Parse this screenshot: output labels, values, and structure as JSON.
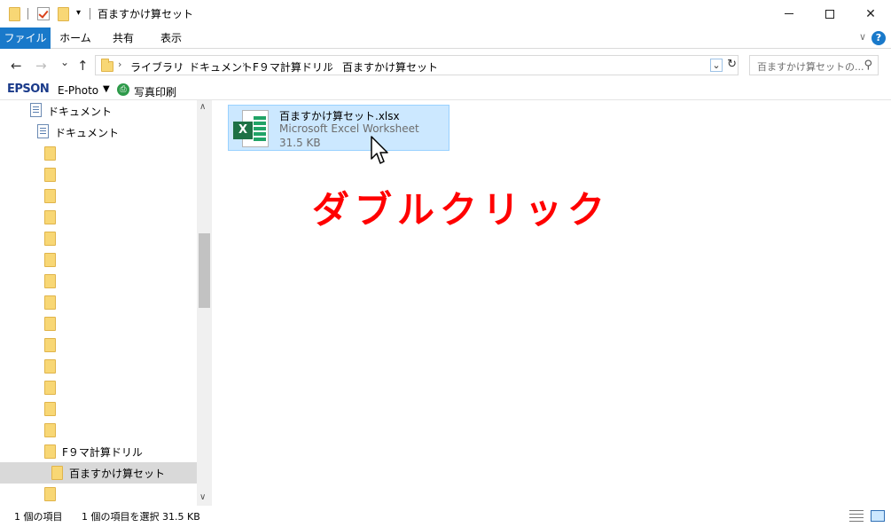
{
  "window": {
    "title": "百ますかけ算セット",
    "minimize": "—",
    "maximize": "",
    "close": "✕"
  },
  "ribbon": {
    "tabs": [
      "ファイル",
      "ホーム",
      "共有",
      "表示"
    ],
    "collapse_icon": "chevron-down-icon",
    "help": "?"
  },
  "address": {
    "back": "←",
    "forward": "→",
    "recent": "⌄",
    "up": "↑",
    "crumbs": [
      "ライブラリ",
      "ドキュメント",
      "F９マ計算ドリル",
      "百ますかけ算セット"
    ],
    "separator": "›",
    "dropdown": "⌄",
    "refresh": "↻",
    "search_placeholder": "百ますかけ算セットの..."
  },
  "epson": {
    "logo": "EPSON",
    "app": "E-Photo",
    "dropdown": "▼",
    "print_label": "写真印刷"
  },
  "navpane": {
    "items": [
      {
        "label": "ドキュメント",
        "icon": "document-library-icon",
        "indent": 1
      },
      {
        "label": "ドキュメント",
        "icon": "document-library-icon",
        "indent": 2
      },
      {
        "label": "",
        "icon": "folder-icon",
        "indent": 3
      },
      {
        "label": "",
        "icon": "folder-icon",
        "indent": 3
      },
      {
        "label": "",
        "icon": "folder-icon",
        "indent": 3
      },
      {
        "label": "",
        "icon": "folder-icon",
        "indent": 3
      },
      {
        "label": "",
        "icon": "folder-icon",
        "indent": 3
      },
      {
        "label": "",
        "icon": "folder-icon",
        "indent": 3
      },
      {
        "label": "",
        "icon": "folder-icon",
        "indent": 3
      },
      {
        "label": "",
        "icon": "folder-icon",
        "indent": 3
      },
      {
        "label": "",
        "icon": "folder-icon",
        "indent": 3
      },
      {
        "label": "",
        "icon": "folder-icon",
        "indent": 3
      },
      {
        "label": "",
        "icon": "folder-icon",
        "indent": 3
      },
      {
        "label": "",
        "icon": "folder-icon",
        "indent": 3
      },
      {
        "label": "",
        "icon": "folder-icon",
        "indent": 3
      },
      {
        "label": "",
        "icon": "folder-icon",
        "indent": 3
      },
      {
        "label": "F９マ計算ドリル",
        "icon": "folder-icon",
        "indent": 3
      },
      {
        "label": "百ますかけ算セット",
        "icon": "folder-icon",
        "indent": 4,
        "selected": true
      },
      {
        "label": "",
        "icon": "folder-icon",
        "indent": 3
      }
    ],
    "scroll_up": "∧",
    "scroll_down": "∨"
  },
  "content": {
    "file": {
      "name": "百ますかけ算セット.xlsx",
      "type": "Microsoft Excel Worksheet",
      "size": "31.5 KB",
      "icon": "excel-file-icon",
      "badge": "X"
    },
    "callout": "ダブルクリック"
  },
  "status": {
    "item_count": "1 個の項目",
    "selection": "1 個の項目を選択  31.5 KB"
  },
  "colors": {
    "accent": "#1979ca",
    "selection_bg": "#cce8ff",
    "selection_border": "#99d1ff",
    "callout": "#ff0000",
    "excel_green": "#1e7145"
  }
}
